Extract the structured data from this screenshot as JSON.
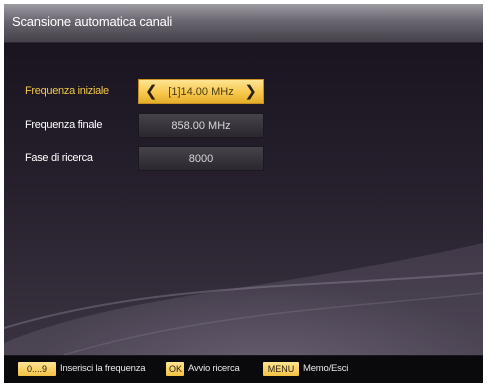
{
  "header": {
    "title": "Scansione automatica canali"
  },
  "rows": [
    {
      "label": "Frequenza iniziale",
      "value": "[1]14.00 MHz",
      "left_arrow": "❮",
      "right_arrow": "❯"
    },
    {
      "label": "Frequenza finale",
      "value": "858.00 MHz"
    },
    {
      "label": "Fase di ricerca",
      "value": "8000"
    }
  ],
  "footer": {
    "keys": [
      {
        "key": "0....9",
        "hint": "Inserisci la frequenza"
      },
      {
        "key": "OK",
        "hint": "Avvio ricerca"
      },
      {
        "key": "MENU",
        "hint": "Memo/Esci"
      }
    ]
  },
  "colors": {
    "accent": "#f7c94e",
    "selected_label": "#f2c84b",
    "background": "#1b1620"
  }
}
